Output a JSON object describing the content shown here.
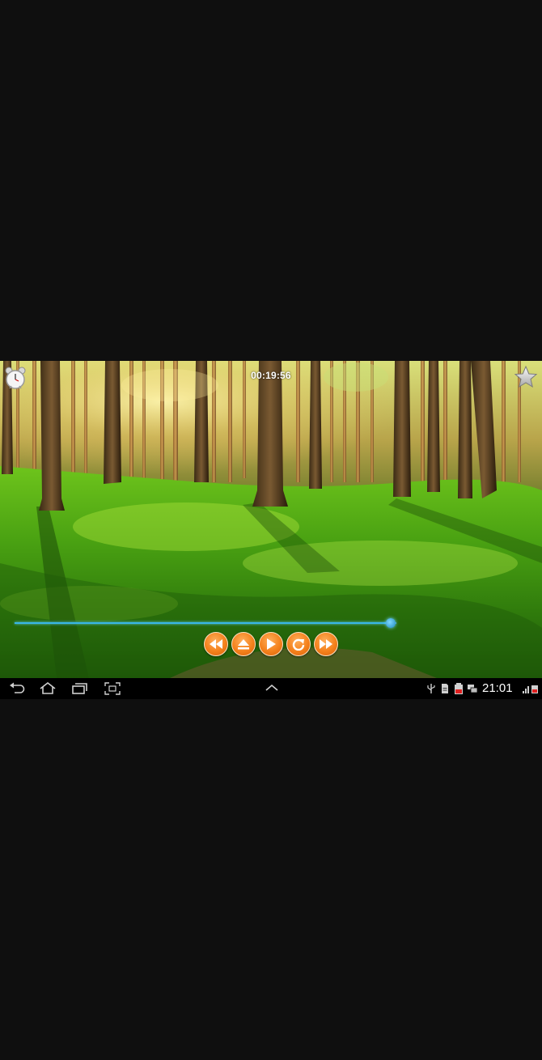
{
  "player": {
    "elapsed_time": "00:19:56",
    "progress_fraction": 0.985,
    "controls": [
      {
        "icon": "rewind-icon"
      },
      {
        "icon": "eject-icon"
      },
      {
        "icon": "play-icon"
      },
      {
        "icon": "repeat-icon"
      },
      {
        "icon": "fast-forward-icon"
      }
    ],
    "accent_color": "#f4811c",
    "seek_color": "#39b6e6",
    "scene": "forest-background"
  },
  "top_icons": {
    "left": "alarm-clock-icon",
    "right": "star-icon"
  },
  "navbar": {
    "buttons": [
      "back-icon",
      "home-icon",
      "recent-apps-icon",
      "screenshot-icon",
      "chevron-up-icon"
    ],
    "status_icons": [
      "usb-icon",
      "sd-card-icon",
      "battery-icon",
      "chat-icon",
      "signal-icon"
    ],
    "clock": "21:01"
  }
}
